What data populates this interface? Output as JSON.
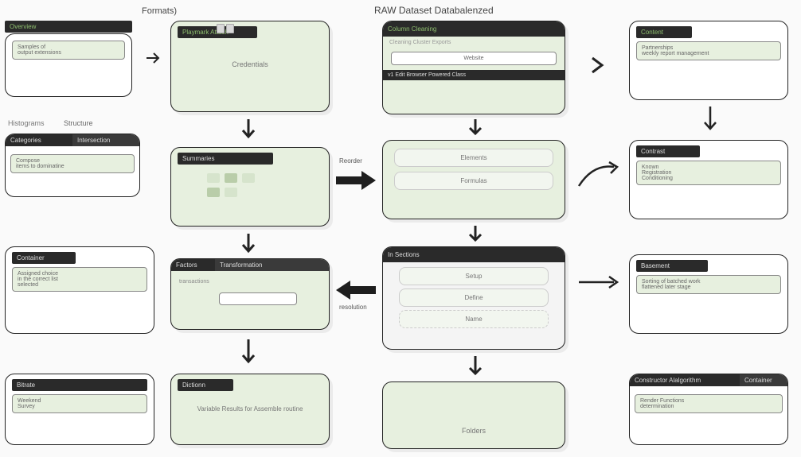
{
  "headings": {
    "formats": "Formats)",
    "main": "RAW Dataset Databalenzed",
    "histograms": "Histograms",
    "structure": "Structure"
  },
  "col1": {
    "box1_bar": "Overview",
    "box1_inner_title": "Samples of",
    "box1_inner_sub": "output extensions",
    "box2_bar1": "Categories",
    "box2_bar2": "Intersection",
    "box2_inner_title": "Compose",
    "box2_inner_sub": "items to dominatine",
    "box3_bar": "Container",
    "box3_inner_l1": "Assigned choice",
    "box3_inner_l2": "in the correct list",
    "box3_inner_l3": "selected",
    "box4_bar": "Bitrate",
    "box4_inner_title": "Weekend",
    "box4_inner_sub": "Survey"
  },
  "col2": {
    "box1_bar": "Playmark Attach",
    "box1_center": "Credentials",
    "box2_bar": "Summaries",
    "box3_bar1": "Factors",
    "box3_bar2": "Transformation",
    "box3_sub": "transactions",
    "box4_bar": "Dictionn",
    "box4_inner": "Variable Results for Assemble routine"
  },
  "col3": {
    "box1_bar": "Column Cleaning",
    "box1_sub": "Cleaning Cluster Exports",
    "box1_center": "Website",
    "box1_footer": "v1 Edit Browser Powered Class",
    "box2_pill1": "Elements",
    "box2_pill2": "Formulas",
    "box3_bar": "In Sections",
    "box3_pill1": "Setup",
    "box3_pill2": "Define",
    "box3_pill3": "Name",
    "box4_center": "Folders"
  },
  "col4": {
    "box1_bar": "Content",
    "box1_inner_title": "Partnerships",
    "box1_inner_sub": "weekly report management",
    "box2_bar": "Contrast",
    "box2_inner_l1": "Known",
    "box2_inner_l2": "Registration",
    "box2_inner_l3": "Conditioning",
    "box3_bar": "Basement",
    "box3_inner_l1": "Sorting of batched work",
    "box3_inner_l2": "flattened later stage",
    "box4_bar1": "Constructor Alalgorithm",
    "box4_bar2": "Container",
    "box4_inner_l1": "Render Functions",
    "box4_inner_l2": "determination"
  },
  "arrows": {
    "reorder": "Reorder",
    "resolution": "resolution"
  }
}
